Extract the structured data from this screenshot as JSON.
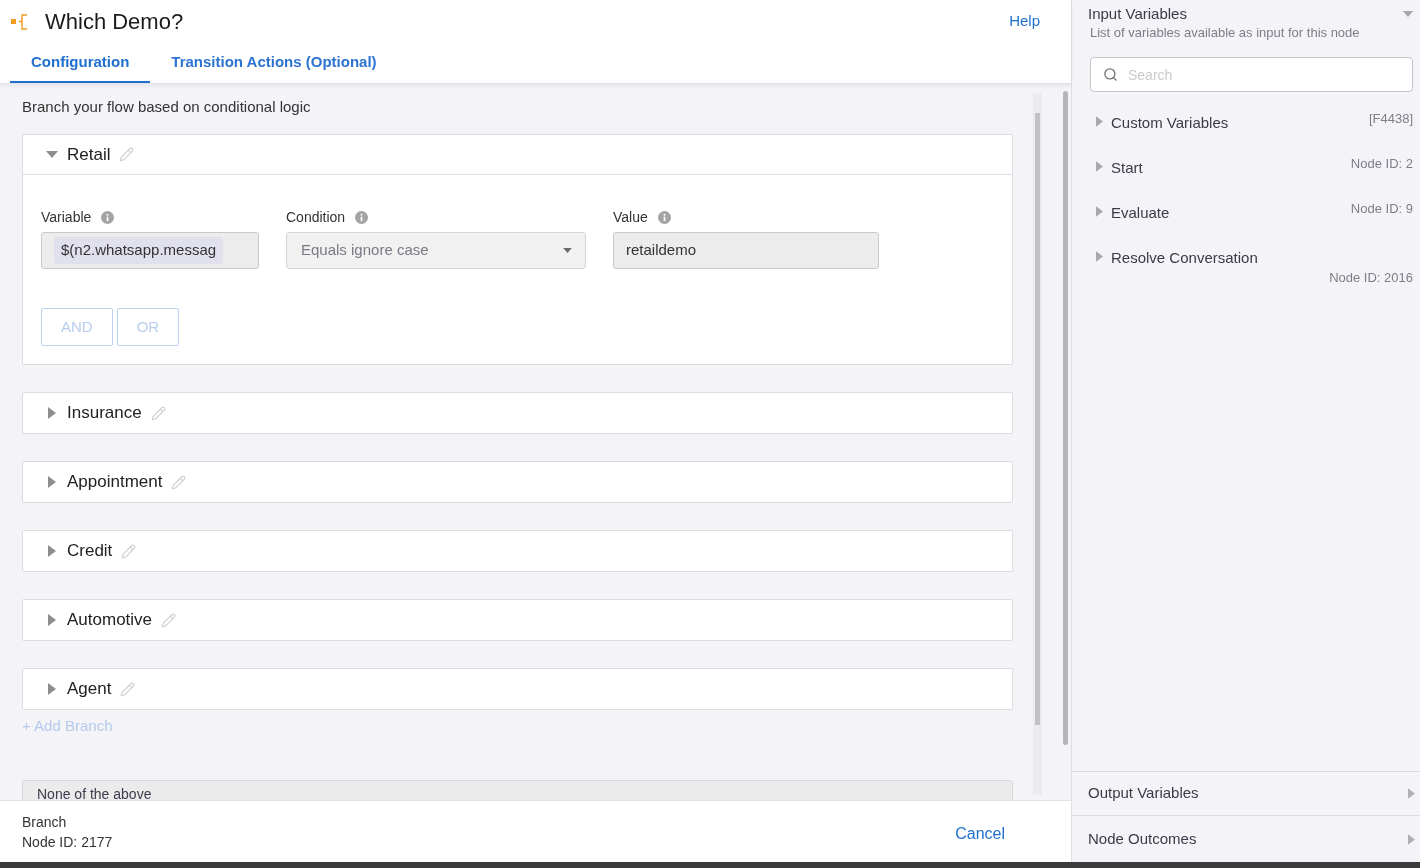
{
  "header": {
    "title": "Which Demo?",
    "help_link": "Help"
  },
  "tabs": [
    {
      "label": "Configuration",
      "selected": true
    },
    {
      "label": "Transition Actions (Optional)",
      "selected": false
    }
  ],
  "description": "Branch your flow based on conditional logic",
  "branches": [
    {
      "name": "Retail",
      "expanded": true,
      "conditions": [
        {
          "fields": [
            {
              "kind": "chip",
              "label": "Variable",
              "value": "$(n2.whatsapp.messag"
            },
            {
              "kind": "dropdown",
              "label": "Condition",
              "value": "Equals ignore case"
            },
            {
              "kind": "text",
              "label": "Value",
              "value": "retaildemo"
            }
          ]
        }
      ],
      "buttons": [
        {
          "label": "AND",
          "disabled": true
        },
        {
          "label": "OR",
          "disabled": true
        }
      ]
    },
    {
      "name": "Insurance",
      "expanded": false
    },
    {
      "name": "Appointment",
      "expanded": false
    },
    {
      "name": "Credit",
      "expanded": false
    },
    {
      "name": "Automotive",
      "expanded": false
    },
    {
      "name": "Agent",
      "expanded": false
    }
  ],
  "add_branch": "+ Add Branch",
  "default_branch": "None of the above",
  "footer": {
    "node_type": "Branch",
    "node_id": "Node ID: 2177",
    "cancel": "Cancel"
  },
  "input_variables": {
    "title": "Input Variables",
    "expanded": true,
    "subtitle": "List of variables available as input for this node",
    "search": {
      "placeholder": "Search"
    },
    "items": [
      {
        "label": "Custom Variables",
        "meta": "[F4438]",
        "expanded": false
      },
      {
        "label": "Start",
        "meta": "Node ID: 2",
        "expanded": false
      },
      {
        "label": "Evaluate",
        "meta": "Node ID: 9",
        "expanded": false
      },
      {
        "label": "Resolve Conversation",
        "meta": "Node ID: 2016",
        "expanded": false
      }
    ]
  },
  "sections": [
    {
      "title": "Output Variables",
      "expanded": false
    },
    {
      "title": "Node Outcomes",
      "expanded": false
    }
  ]
}
